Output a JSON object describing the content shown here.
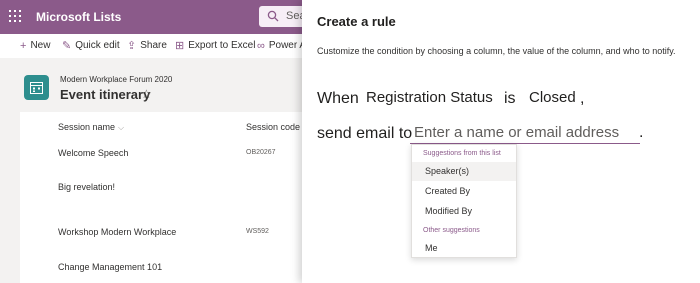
{
  "app": {
    "title": "Microsoft Lists",
    "search_placeholder": "Sea"
  },
  "toolbar": {
    "new_label": "New",
    "quick_edit_label": "Quick edit",
    "share_label": "Share",
    "export_label": "Export to Excel",
    "power_label": "Power A"
  },
  "list": {
    "site_name": "Modern Workplace Forum 2020",
    "title": "Event itinerary",
    "columns": [
      "Session name",
      "Session code"
    ],
    "rows": [
      {
        "name": "Welcome Speech",
        "code": "OB20267"
      },
      {
        "name": "Big revelation!",
        "code": ""
      },
      {
        "name": "Workshop Modern Workplace",
        "code": "WS592"
      },
      {
        "name": "Change Management 101",
        "code": ""
      }
    ]
  },
  "panel": {
    "title": "Create a rule",
    "description": "Customize the condition by choosing a column, the value of the column, and who to notify.",
    "rule": {
      "when_word": "When",
      "column": "Registration Status",
      "is_word": "is",
      "value": "Closed",
      "comma": ",",
      "send_text": "send email to",
      "email_placeholder": "Enter a name or email address",
      "period": "."
    },
    "suggestions": {
      "list_header": "Suggestions from this list",
      "list_items": [
        "Speaker(s)",
        "Created By",
        "Modified By"
      ],
      "other_header": "Other suggestions",
      "other_items": [
        "Me"
      ]
    }
  },
  "colors": {
    "brand": "#8b5a8a",
    "list_icon": "#2d8e8e"
  }
}
